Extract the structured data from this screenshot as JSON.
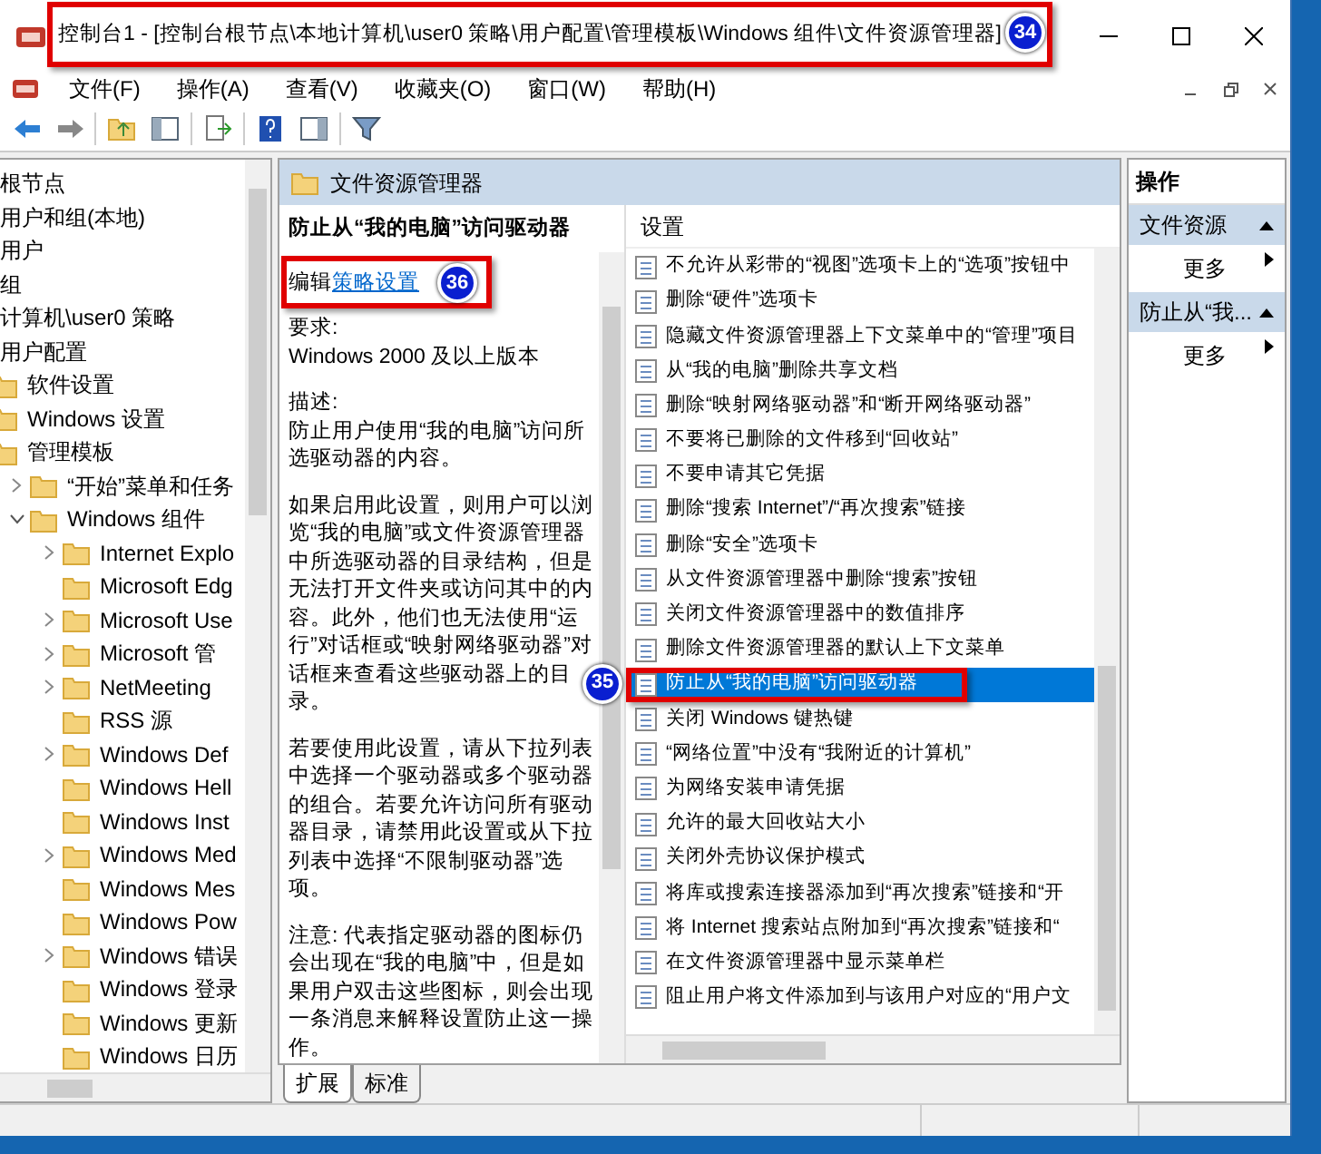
{
  "window": {
    "title": "控制台1 - [控制台根节点\\本地计算机\\user0 策略\\用户配置\\管理模板\\Windows 组件\\文件资源管理器]"
  },
  "menu": [
    "文件(F)",
    "操作(A)",
    "查看(V)",
    "收藏夹(O)",
    "窗口(W)",
    "帮助(H)"
  ],
  "tree": [
    {
      "label": "根节点",
      "kind": "node"
    },
    {
      "label": "用户和组(本地)",
      "kind": "node"
    },
    {
      "label": "用户",
      "kind": "node"
    },
    {
      "label": "组",
      "kind": "node"
    },
    {
      "label": "计算机\\user0 策略",
      "kind": "node"
    },
    {
      "label": "用户配置",
      "kind": "node"
    },
    {
      "label": "软件设置",
      "kind": "folder"
    },
    {
      "label": "Windows 设置",
      "kind": "folder"
    },
    {
      "label": "管理模板",
      "kind": "folder",
      "children": [
        {
          "label": "“开始”菜单和任务",
          "kind": "folder",
          "expanded": false
        },
        {
          "label": "Windows 组件",
          "kind": "folder",
          "expanded": true,
          "children": [
            {
              "label": "Internet Explo",
              "kind": "folder",
              "expanded": false
            },
            {
              "label": "Microsoft Edg",
              "kind": "folder"
            },
            {
              "label": "Microsoft Use",
              "kind": "folder",
              "expanded": false
            },
            {
              "label": "Microsoft 管",
              "kind": "folder",
              "expanded": false
            },
            {
              "label": "NetMeeting",
              "kind": "folder",
              "expanded": false
            },
            {
              "label": "RSS 源",
              "kind": "folder"
            },
            {
              "label": "Windows Def",
              "kind": "folder",
              "expanded": false
            },
            {
              "label": "Windows Hell",
              "kind": "folder"
            },
            {
              "label": "Windows Inst",
              "kind": "folder"
            },
            {
              "label": "Windows Med",
              "kind": "folder",
              "expanded": false
            },
            {
              "label": "Windows Mes",
              "kind": "folder"
            },
            {
              "label": "Windows Pow",
              "kind": "folder"
            },
            {
              "label": "Windows 错误",
              "kind": "folder",
              "expanded": false
            },
            {
              "label": "Windows 登录",
              "kind": "folder"
            },
            {
              "label": "Windows 更新",
              "kind": "folder"
            },
            {
              "label": "Windows 日历",
              "kind": "folder"
            }
          ]
        }
      ]
    }
  ],
  "detail": {
    "header": "文件资源管理器",
    "title": "防止从“我的电脑”访问驱动器",
    "edit_prefix": "编辑",
    "edit_link": "策略设置",
    "paragraphs": [
      [
        "要求:",
        "Windows 2000 及以上版本"
      ],
      [
        "描述:",
        "防止用户使用“我的电脑”访问所选驱动器的内容。"
      ],
      [
        "如果启用此设置，则用户可以浏览“我的电脑”或文件资源管理器中所选驱动器的目录结构，但是无法打开文件夹或访问其中的内容。此外，他们也无法使用“运行”对话框或“映射网络驱动器”对话框来查看这些驱动器上的目录。"
      ],
      [
        "若要使用此设置，请从下拉列表中选择一个驱动器或多个驱动器的组合。若要允许访问所有驱动器目录，请禁用此设置或从下拉列表中选择“不限制驱动器”选项。"
      ],
      [
        "注意: 代表指定驱动器的图标仍会出现在“我的电脑”中，但是如果用户双击这些图标，则会出现一条消息来解释设置防止这一操作。"
      ]
    ]
  },
  "settings": {
    "column": "设置",
    "rows": [
      {
        "label": "不允许从彩带的“视图”选项卡上的“选项”按钮中",
        "selected": false
      },
      {
        "label": "删除“硬件”选项卡",
        "selected": false
      },
      {
        "label": "隐藏文件资源管理器上下文菜单中的“管理”项目",
        "selected": false
      },
      {
        "label": "从“我的电脑”删除共享文档",
        "selected": false
      },
      {
        "label": "删除“映射网络驱动器”和“断开网络驱动器”",
        "selected": false
      },
      {
        "label": "不要将已删除的文件移到“回收站”",
        "selected": false
      },
      {
        "label": "不要申请其它凭据",
        "selected": false
      },
      {
        "label": "删除“搜索 Internet”/“再次搜索”链接",
        "selected": false
      },
      {
        "label": "删除“安全”选项卡",
        "selected": false
      },
      {
        "label": "从文件资源管理器中删除“搜索”按钮",
        "selected": false
      },
      {
        "label": "关闭文件资源管理器中的数值排序",
        "selected": false
      },
      {
        "label": "删除文件资源管理器的默认上下文菜单",
        "selected": false
      },
      {
        "label": "防止从“我的电脑”访问驱动器",
        "selected": true
      },
      {
        "label": "关闭 Windows 键热键",
        "selected": false
      },
      {
        "label": "“网络位置”中没有“我附近的计算机”",
        "selected": false
      },
      {
        "label": "为网络安装申请凭据",
        "selected": false
      },
      {
        "label": "允许的最大回收站大小",
        "selected": false
      },
      {
        "label": "关闭外壳协议保护模式",
        "selected": false
      },
      {
        "label": "将库或搜索连接器添加到“再次搜索”链接和“开",
        "selected": false
      },
      {
        "label": "将 Internet 搜索站点附加到“再次搜索”链接和“",
        "selected": false
      },
      {
        "label": "在文件资源管理器中显示菜单栏",
        "selected": false
      },
      {
        "label": "阻止用户将文件添加到与该用户对应的“用户文",
        "selected": false
      }
    ]
  },
  "actions": {
    "title": "操作",
    "groups": [
      {
        "title": "文件资源",
        "items": [
          "更多"
        ]
      },
      {
        "title": "防止从“我...",
        "items": [
          "更多"
        ]
      }
    ]
  },
  "view_tabs": [
    {
      "label": "扩展",
      "selected": true
    },
    {
      "label": "标准",
      "selected": false
    }
  ],
  "annotations": [
    {
      "label": "34",
      "kind": "title"
    },
    {
      "label": "36",
      "kind": "edit"
    },
    {
      "label": "35",
      "kind": "row"
    }
  ]
}
